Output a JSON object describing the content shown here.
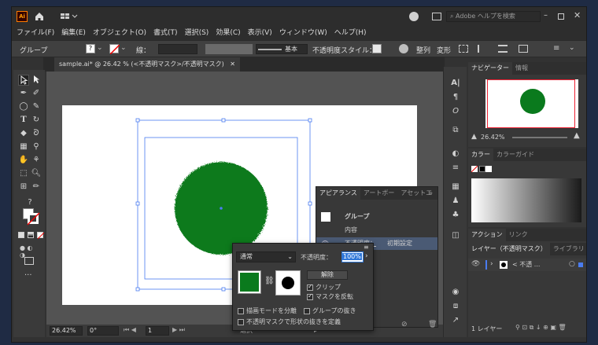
{
  "titlebar": {
    "logo": "Ai",
    "search_placeholder": "Adobe ヘルプを検索"
  },
  "menu": [
    "ファイル(F)",
    "編集(E)",
    "オブジェクト(O)",
    "書式(T)",
    "選択(S)",
    "効果(C)",
    "表示(V)",
    "ウィンドウ(W)",
    "ヘルプ(H)"
  ],
  "controlbar": {
    "selection_label": "グループ",
    "stroke_label": "線：",
    "stroke_style": "基本",
    "opacity_label": "不透明度",
    "style_label": "スタイル：",
    "align_label": "整列",
    "transform_label": "変形"
  },
  "document": {
    "tab_title": "sample.ai* @ 26.42 % (<不透明マスク>/不透明マスク)"
  },
  "statusbar": {
    "zoom": "26.42%",
    "rotation": "0°",
    "artboard": "1",
    "tool": "選択"
  },
  "navigator": {
    "tabs": [
      "ナビゲーター",
      "情報"
    ],
    "zoom": "26.42%"
  },
  "color_panel": {
    "tabs": [
      "カラー",
      "カラーガイド"
    ]
  },
  "actions_panel": {
    "tabs": [
      "アクション",
      "リンク"
    ]
  },
  "layers_panel": {
    "tabs": [
      "レイヤー（不透明マスク）",
      "ライブラリ"
    ],
    "layer_name": "< 不透 ...",
    "footer_count": "1 レイヤー"
  },
  "appearance_panel": {
    "tabs": [
      "アピアランス",
      "アートボー",
      "アセットエ"
    ],
    "rows": {
      "group": "グループ",
      "contents": "内容",
      "opacity_label": "不透明度：",
      "opacity_value": "初期設定"
    }
  },
  "opacity_popup": {
    "blend_mode": "通常",
    "opacity_label": "不透明度：",
    "opacity_value": "100%",
    "release_button": "解除",
    "clip_label": "クリップ",
    "invert_label": "マスクを反転",
    "isolate_label": "描画モードを分離",
    "knockout_label": "グループの抜き",
    "define_label": "不透明マスクで形状の抜きを定義",
    "clip_checked": true,
    "invert_checked": true
  },
  "colors": {
    "circle_green": "#0a7a1d",
    "selection_blue": "#4a7cf0",
    "highlight": "#2f77d8"
  }
}
